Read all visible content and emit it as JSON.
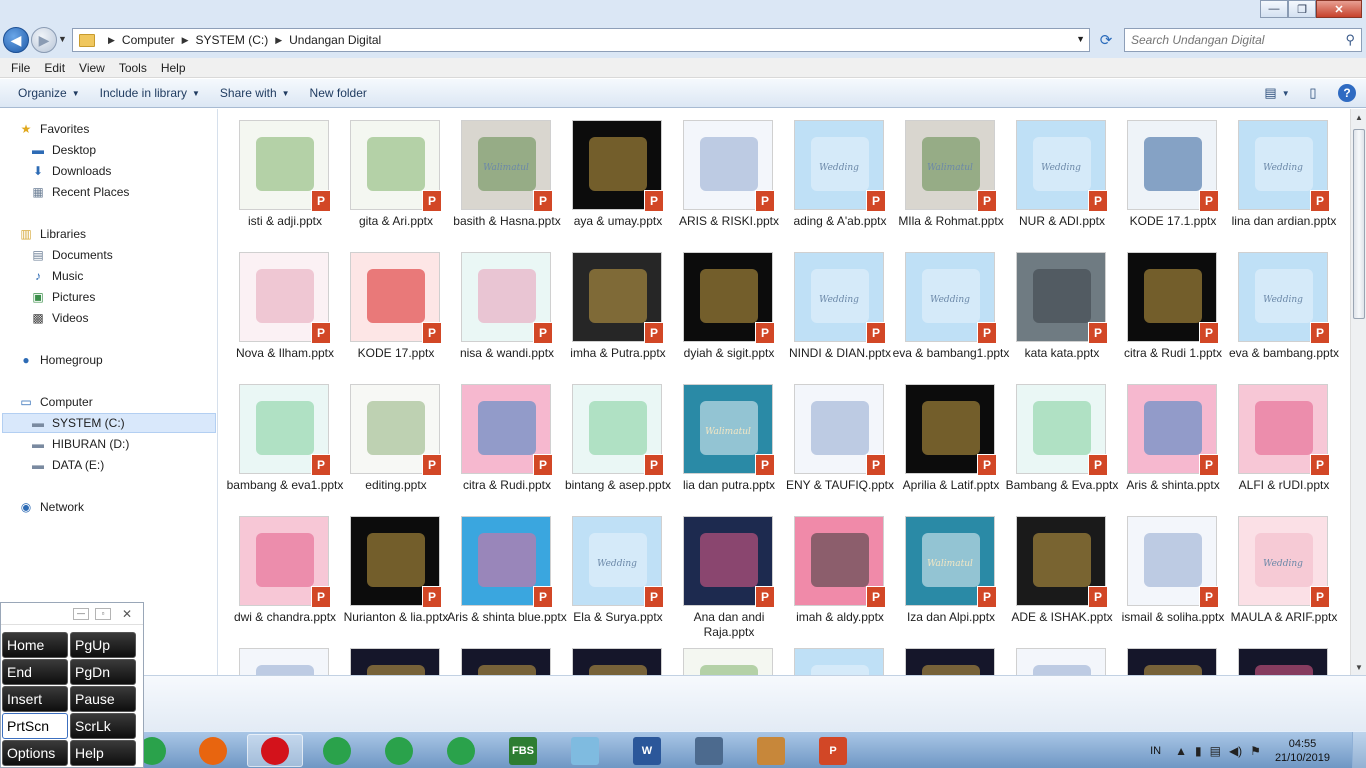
{
  "window": {
    "ctrl_min": "—",
    "ctrl_max": "❐",
    "ctrl_close": "✕"
  },
  "address": {
    "crumbs": [
      "Computer",
      "SYSTEM (C:)",
      "Undangan Digital"
    ],
    "search_placeholder": "Search Undangan Digital"
  },
  "menu": [
    "File",
    "Edit",
    "View",
    "Tools",
    "Help"
  ],
  "toolbar": {
    "organize": "Organize",
    "include": "Include in library",
    "share": "Share with",
    "newfolder": "New folder",
    "help": "?"
  },
  "nav": {
    "favorites": "Favorites",
    "desktop": "Desktop",
    "downloads": "Downloads",
    "recent": "Recent Places",
    "libraries": "Libraries",
    "documents": "Documents",
    "music": "Music",
    "pictures": "Pictures",
    "videos": "Videos",
    "homegroup": "Homegroup",
    "computer": "Computer",
    "system": "SYSTEM (C:)",
    "hiburan": "HIBURAN (D:)",
    "data": "DATA (E:)",
    "network": "Network"
  },
  "files": [
    {
      "name": "isti & adji.pptx",
      "bg": "#f4f7f1",
      "accent": "#7fb26a",
      "title": ""
    },
    {
      "name": "gita & Ari.pptx",
      "bg": "#f4f7f1",
      "accent": "#7fb26a",
      "title": ""
    },
    {
      "name": "basith & Hasna.pptx",
      "bg": "#d9d6cf",
      "accent": "#5e8b4a",
      "title": "Walimatul"
    },
    {
      "name": "aya & umay.pptx",
      "bg": "#0c0c0c",
      "accent": "#c9a245",
      "title": ""
    },
    {
      "name": "ARIS & RISKI.pptx",
      "bg": "#f3f6fb",
      "accent": "#8fa8cf",
      "title": ""
    },
    {
      "name": "ading & A'ab.pptx",
      "bg": "#bfe0f6",
      "accent": "#e7f3fb",
      "title": "Wedding"
    },
    {
      "name": "MIla & Rohmat.pptx",
      "bg": "#d9d6cf",
      "accent": "#5e8b4a",
      "title": "Walimatul"
    },
    {
      "name": "NUR & ADI.pptx",
      "bg": "#bfe0f6",
      "accent": "#e7f3fb",
      "title": "Wedding"
    },
    {
      "name": "KODE 17.1.pptx",
      "bg": "#eef3f8",
      "accent": "#2f5f9b",
      "title": ""
    },
    {
      "name": "lina dan ardian.pptx",
      "bg": "#bfe0f6",
      "accent": "#e7f3fb",
      "title": "Wedding"
    },
    {
      "name": "Nova & Ilham.pptx",
      "bg": "#fbf1f4",
      "accent": "#e6a4b8",
      "title": ""
    },
    {
      "name": "KODE 17.pptx",
      "bg": "#fde6e6",
      "accent": "#d81f1f",
      "title": ""
    },
    {
      "name": "nisa & wandi.pptx",
      "bg": "#eaf7f5",
      "accent": "#e89cb6",
      "title": ""
    },
    {
      "name": "imha & Putra.pptx",
      "bg": "#262626",
      "accent": "#c9a245",
      "title": ""
    },
    {
      "name": "dyiah & sigit.pptx",
      "bg": "#0c0c0c",
      "accent": "#c9a245",
      "title": ""
    },
    {
      "name": "NINDI & DIAN.pptx",
      "bg": "#bfe0f6",
      "accent": "#e7f3fb",
      "title": "Wedding"
    },
    {
      "name": "eva & bambang1.pptx",
      "bg": "#bfe0f6",
      "accent": "#e7f3fb",
      "title": "Wedding"
    },
    {
      "name": "kata kata.pptx",
      "bg": "#6f7b82",
      "accent": "#3a4248",
      "title": ""
    },
    {
      "name": "citra & Rudi 1.pptx",
      "bg": "#0c0c0c",
      "accent": "#c9a245",
      "title": ""
    },
    {
      "name": "eva & bambang.pptx",
      "bg": "#bfe0f6",
      "accent": "#e7f3fb",
      "title": "Wedding"
    },
    {
      "name": "bambang & eva1.pptx",
      "bg": "#eaf7f5",
      "accent": "#7fcf9a",
      "title": ""
    },
    {
      "name": "editing.pptx",
      "bg": "#f7f8f5",
      "accent": "#8fb07a",
      "title": ""
    },
    {
      "name": "citra & Rudi.pptx",
      "bg": "#f6b8cf",
      "accent": "#3f83c4",
      "title": ""
    },
    {
      "name": "bintang & asep.pptx",
      "bg": "#eaf7f5",
      "accent": "#7fcf9a",
      "title": ""
    },
    {
      "name": "lia dan putra.pptx",
      "bg": "#2a8aa6",
      "accent": "#e9f4f7",
      "title": "Walimatul"
    },
    {
      "name": "ENY & TAUFIQ.pptx",
      "bg": "#f3f6fb",
      "accent": "#8fa8cf",
      "title": ""
    },
    {
      "name": "Aprilia & Latif.pptx",
      "bg": "#0c0c0c",
      "accent": "#c9a245",
      "title": ""
    },
    {
      "name": "Bambang & Eva.pptx",
      "bg": "#eaf7f5",
      "accent": "#7fcf9a",
      "title": ""
    },
    {
      "name": "Aris & shinta.pptx",
      "bg": "#f6b8cf",
      "accent": "#3f83c4",
      "title": ""
    },
    {
      "name": "ALFI & rUDI.pptx",
      "bg": "#f7c7d6",
      "accent": "#e35d8b",
      "title": ""
    },
    {
      "name": "dwi & chandra.pptx",
      "bg": "#f7c7d6",
      "accent": "#e35d8b",
      "title": ""
    },
    {
      "name": "Nurianton & lia.pptx",
      "bg": "#0c0c0c",
      "accent": "#c9a245",
      "title": ""
    },
    {
      "name": "Aris & shinta blue.pptx",
      "bg": "#3aa6df",
      "accent": "#e86b9a",
      "title": ""
    },
    {
      "name": "Ela & Surya.pptx",
      "bg": "#bfe0f6",
      "accent": "#e7f3fb",
      "title": "Wedding"
    },
    {
      "name": "Ana dan andi Raja.pptx",
      "bg": "#1d2a4f",
      "accent": "#e35d8b",
      "title": ""
    },
    {
      "name": "imah & aldy.pptx",
      "bg": "#f08aa9",
      "accent": "#3a3a3a",
      "title": ""
    },
    {
      "name": "Iza dan Alpi.pptx",
      "bg": "#2a8aa6",
      "accent": "#e9f4f7",
      "title": "Walimatul"
    },
    {
      "name": "ADE & ISHAK.pptx",
      "bg": "#1a1a1a",
      "accent": "#c9a245",
      "title": ""
    },
    {
      "name": "ismail & soliha.pptx",
      "bg": "#f3f6fb",
      "accent": "#8fa8cf",
      "title": ""
    },
    {
      "name": "MAULA & ARIF.pptx",
      "bg": "#fbe0e6",
      "accent": "#f2b8c6",
      "title": "Wedding"
    },
    {
      "name": "",
      "bg": "#f3f6fb",
      "accent": "#8fa8cf",
      "title": ""
    },
    {
      "name": "",
      "bg": "#15162a",
      "accent": "#c9a245",
      "title": ""
    },
    {
      "name": "",
      "bg": "#15162a",
      "accent": "#c9a245",
      "title": ""
    },
    {
      "name": "",
      "bg": "#15162a",
      "accent": "#c9a245",
      "title": ""
    },
    {
      "name": "",
      "bg": "#f4f7f1",
      "accent": "#7fb26a",
      "title": ""
    },
    {
      "name": "",
      "bg": "#bfe0f6",
      "accent": "#e7f3fb",
      "title": ""
    },
    {
      "name": "",
      "bg": "#15162a",
      "accent": "#c9a245",
      "title": ""
    },
    {
      "name": "",
      "bg": "#f3f6fb",
      "accent": "#8fa8cf",
      "title": ""
    },
    {
      "name": "",
      "bg": "#15162a",
      "accent": "#c9a245",
      "title": ""
    },
    {
      "name": "",
      "bg": "#15162a",
      "accent": "#e35d8b",
      "title": ""
    }
  ],
  "osk": {
    "keys": [
      "Home",
      "PgUp",
      "End",
      "PgDn",
      "Insert",
      "Pause",
      "PrtScn",
      "ScrLk",
      "Options",
      "Help"
    ],
    "lit": [
      "PrtScn"
    ]
  },
  "taskbar": {
    "apps": [
      {
        "icon": "chrome-icon",
        "color": "#2aa24b",
        "label": ""
      },
      {
        "icon": "firefox-icon",
        "color": "#e8650f",
        "label": ""
      },
      {
        "icon": "opera-icon",
        "color": "#d3121b",
        "label": ""
      },
      {
        "icon": "chrome-icon",
        "color": "#2aa24b",
        "label": ""
      },
      {
        "icon": "chrome-icon",
        "color": "#2aa24b",
        "label": ""
      },
      {
        "icon": "chrome-icon",
        "color": "#2aa24b",
        "label": ""
      },
      {
        "icon": "fbs-icon",
        "color": "#2e7d32",
        "label": "FBS"
      },
      {
        "icon": "notes-icon",
        "color": "#7fbbe0",
        "label": ""
      },
      {
        "icon": "word-icon",
        "color": "#2b579a",
        "label": "W"
      },
      {
        "icon": "keyboard-icon",
        "color": "#4c6a8e",
        "label": ""
      },
      {
        "icon": "paint-icon",
        "color": "#c7873a",
        "label": ""
      },
      {
        "icon": "powerpoint-icon",
        "color": "#d24726",
        "label": "P"
      }
    ],
    "lang": "IN",
    "time": "04:55",
    "date": "21/10/2019"
  }
}
